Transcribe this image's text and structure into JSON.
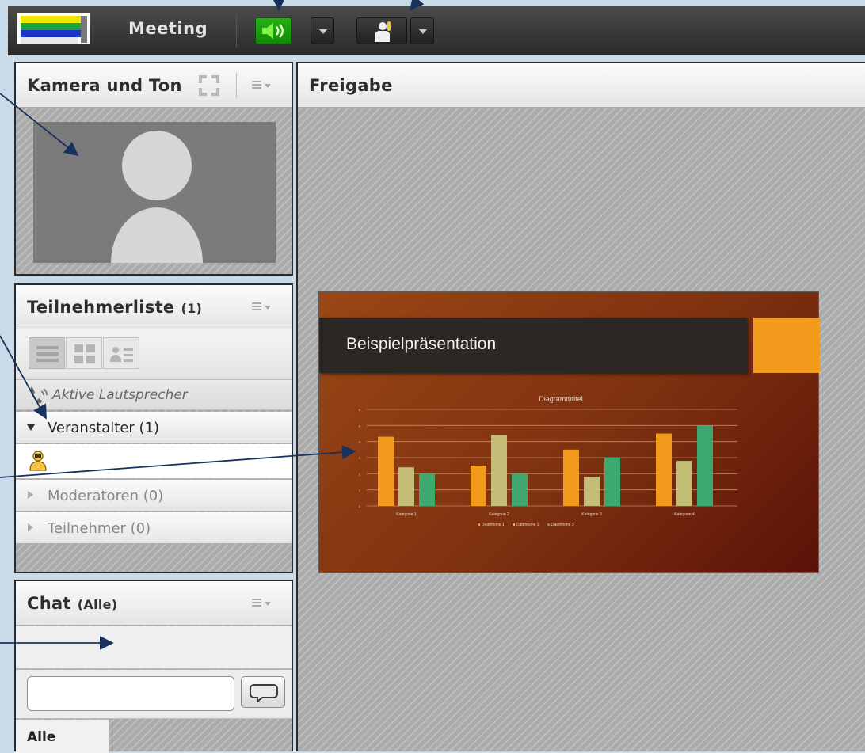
{
  "header": {
    "title": "Meeting",
    "speaker_icon": "speaker-icon",
    "raise_hand_icon": "raise-hand-icon"
  },
  "camera_panel": {
    "title": "Kamera und Ton",
    "fullscreen_icon": "fullscreen-icon",
    "menu_icon": "menu-icon",
    "avatar_icon": "user-placeholder-icon"
  },
  "attendee_panel": {
    "title": "Teilnehmerliste",
    "count": "(1)",
    "active_speakers": "Aktive Lautsprecher",
    "hosts": "Veranstalter (1)",
    "presenters": "Moderatoren (0)",
    "participants": "Teilnehmer (0)"
  },
  "chat_panel": {
    "title": "Chat",
    "scope": "(Alle)",
    "message_input": {
      "value": "",
      "placeholder": ""
    },
    "send_icon": "speech-bubble-icon",
    "tab_all": "Alle"
  },
  "share_panel": {
    "title": "Freigabe",
    "slide_title": "Beispielpräsentation",
    "slide": {
      "chart_data": {
        "type": "bar",
        "title": "Diagrammtitel",
        "categories": [
          "Kategorie 1",
          "Kategorie 2",
          "Kategorie 3",
          "Kategorie 4"
        ],
        "series": [
          {
            "name": "Datenreihe 1",
            "values": [
              4.3,
              2.5,
              3.5,
              4.5
            ],
            "color": "#f19a1c"
          },
          {
            "name": "Datenreihe 2",
            "values": [
              2.4,
              4.4,
              1.8,
              2.8
            ],
            "color": "#c4bd78"
          },
          {
            "name": "Datenreihe 3",
            "values": [
              2,
              2,
              3,
              5
            ],
            "color": "#3ea96f"
          }
        ],
        "ylim": [
          0,
          6
        ],
        "yticks": [
          "0",
          "1",
          "2",
          "3",
          "4",
          "5",
          "6"
        ],
        "grid": true,
        "legend": "bottom"
      }
    }
  },
  "colors": {
    "speaker_active": "#3ec21e",
    "slide_accent": "#f19a1c",
    "slide_bg": "#8a3a12"
  }
}
